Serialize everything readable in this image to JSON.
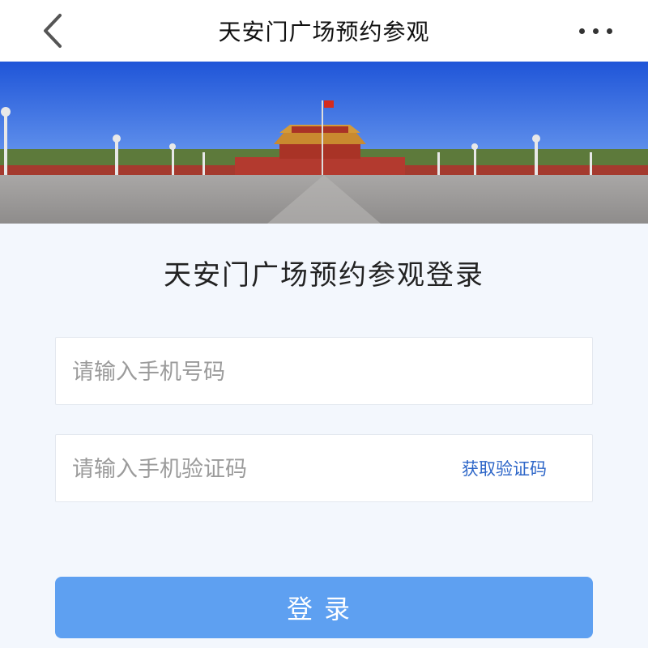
{
  "header": {
    "title": "天安门广场预约参观",
    "back_icon": "chevron-left-icon",
    "more_icon": "more-horizontal-icon"
  },
  "banner": {
    "description_icon": "tiananmen-photo"
  },
  "login": {
    "title": "天安门广场预约参观登录",
    "phone_placeholder": "请输入手机号码",
    "code_placeholder": "请输入手机验证码",
    "get_code_label": "获取验证码",
    "submit_label": "登录"
  },
  "colors": {
    "accent": "#5ea0f1",
    "link": "#2d66c8",
    "background": "#f3f7fd"
  }
}
